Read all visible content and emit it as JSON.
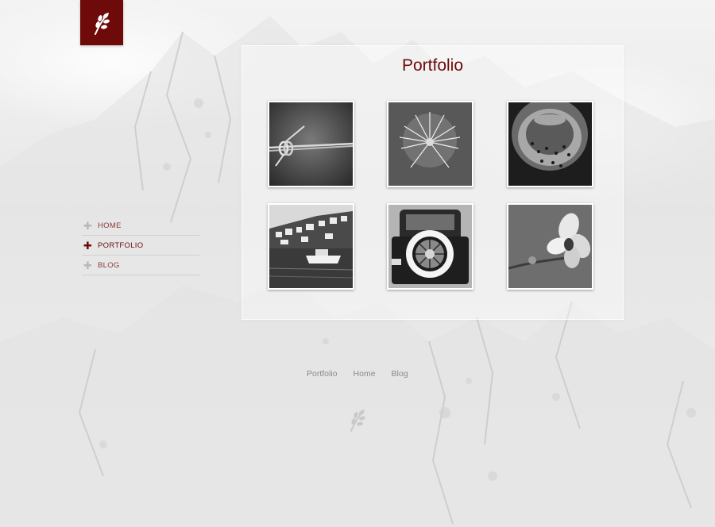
{
  "page": {
    "title": "Portfolio",
    "accent_color": "#6e0a0a"
  },
  "logo": {
    "icon": "leaf-icon"
  },
  "side_nav": {
    "items": [
      {
        "label": "HOME",
        "active": false,
        "icon": "plus-icon"
      },
      {
        "label": "PORTFOLIO",
        "active": true,
        "icon": "plus-icon"
      },
      {
        "label": "BLOG",
        "active": false,
        "icon": "plus-icon"
      }
    ]
  },
  "gallery": {
    "items": [
      {
        "subject": "barbed wire"
      },
      {
        "subject": "dandelion seed head"
      },
      {
        "subject": "water drops on metal"
      },
      {
        "subject": "harbor town"
      },
      {
        "subject": "vintage car spare wheel"
      },
      {
        "subject": "orchid flower"
      }
    ]
  },
  "footer": {
    "links": [
      "Portfolio",
      "Home",
      "Blog"
    ],
    "icon": "leaf-icon"
  }
}
